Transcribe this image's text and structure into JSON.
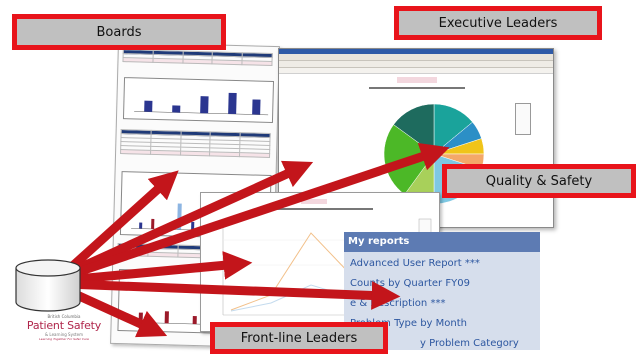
{
  "labels": {
    "boards": "Boards",
    "executive": "Executive Leaders",
    "quality": "Quality & Safety",
    "frontline": "Front-line Leaders"
  },
  "reports_panel": {
    "header": "My reports",
    "items": [
      "Advanced User Report ***",
      "Counts by Quarter FY09",
      "e & Description ***",
      "Problem Type by Month",
      "y Problem Category"
    ]
  },
  "logo": {
    "top": "British Columbia",
    "main": "Patient Safety",
    "sub": "& Learning System",
    "tag": "Learning Together For Safer Care"
  },
  "pie": {
    "slices": [
      {
        "color": "#1aa39b",
        "value": 14
      },
      {
        "color": "#2c8fc6",
        "value": 6
      },
      {
        "color": "#f0c419",
        "value": 5
      },
      {
        "color": "#f4a868",
        "value": 5
      },
      {
        "color": "#7ec8e3",
        "value": 20
      },
      {
        "color": "#a8d05a",
        "value": 10
      },
      {
        "color": "#4cb827",
        "value": 25
      },
      {
        "color": "#1e6b5e",
        "value": 15
      }
    ]
  },
  "colors": {
    "arrow": "#c3151b",
    "callout_border": "#e8141b",
    "callout_fill": "#c0c0c0",
    "bar": "#2b3690"
  }
}
